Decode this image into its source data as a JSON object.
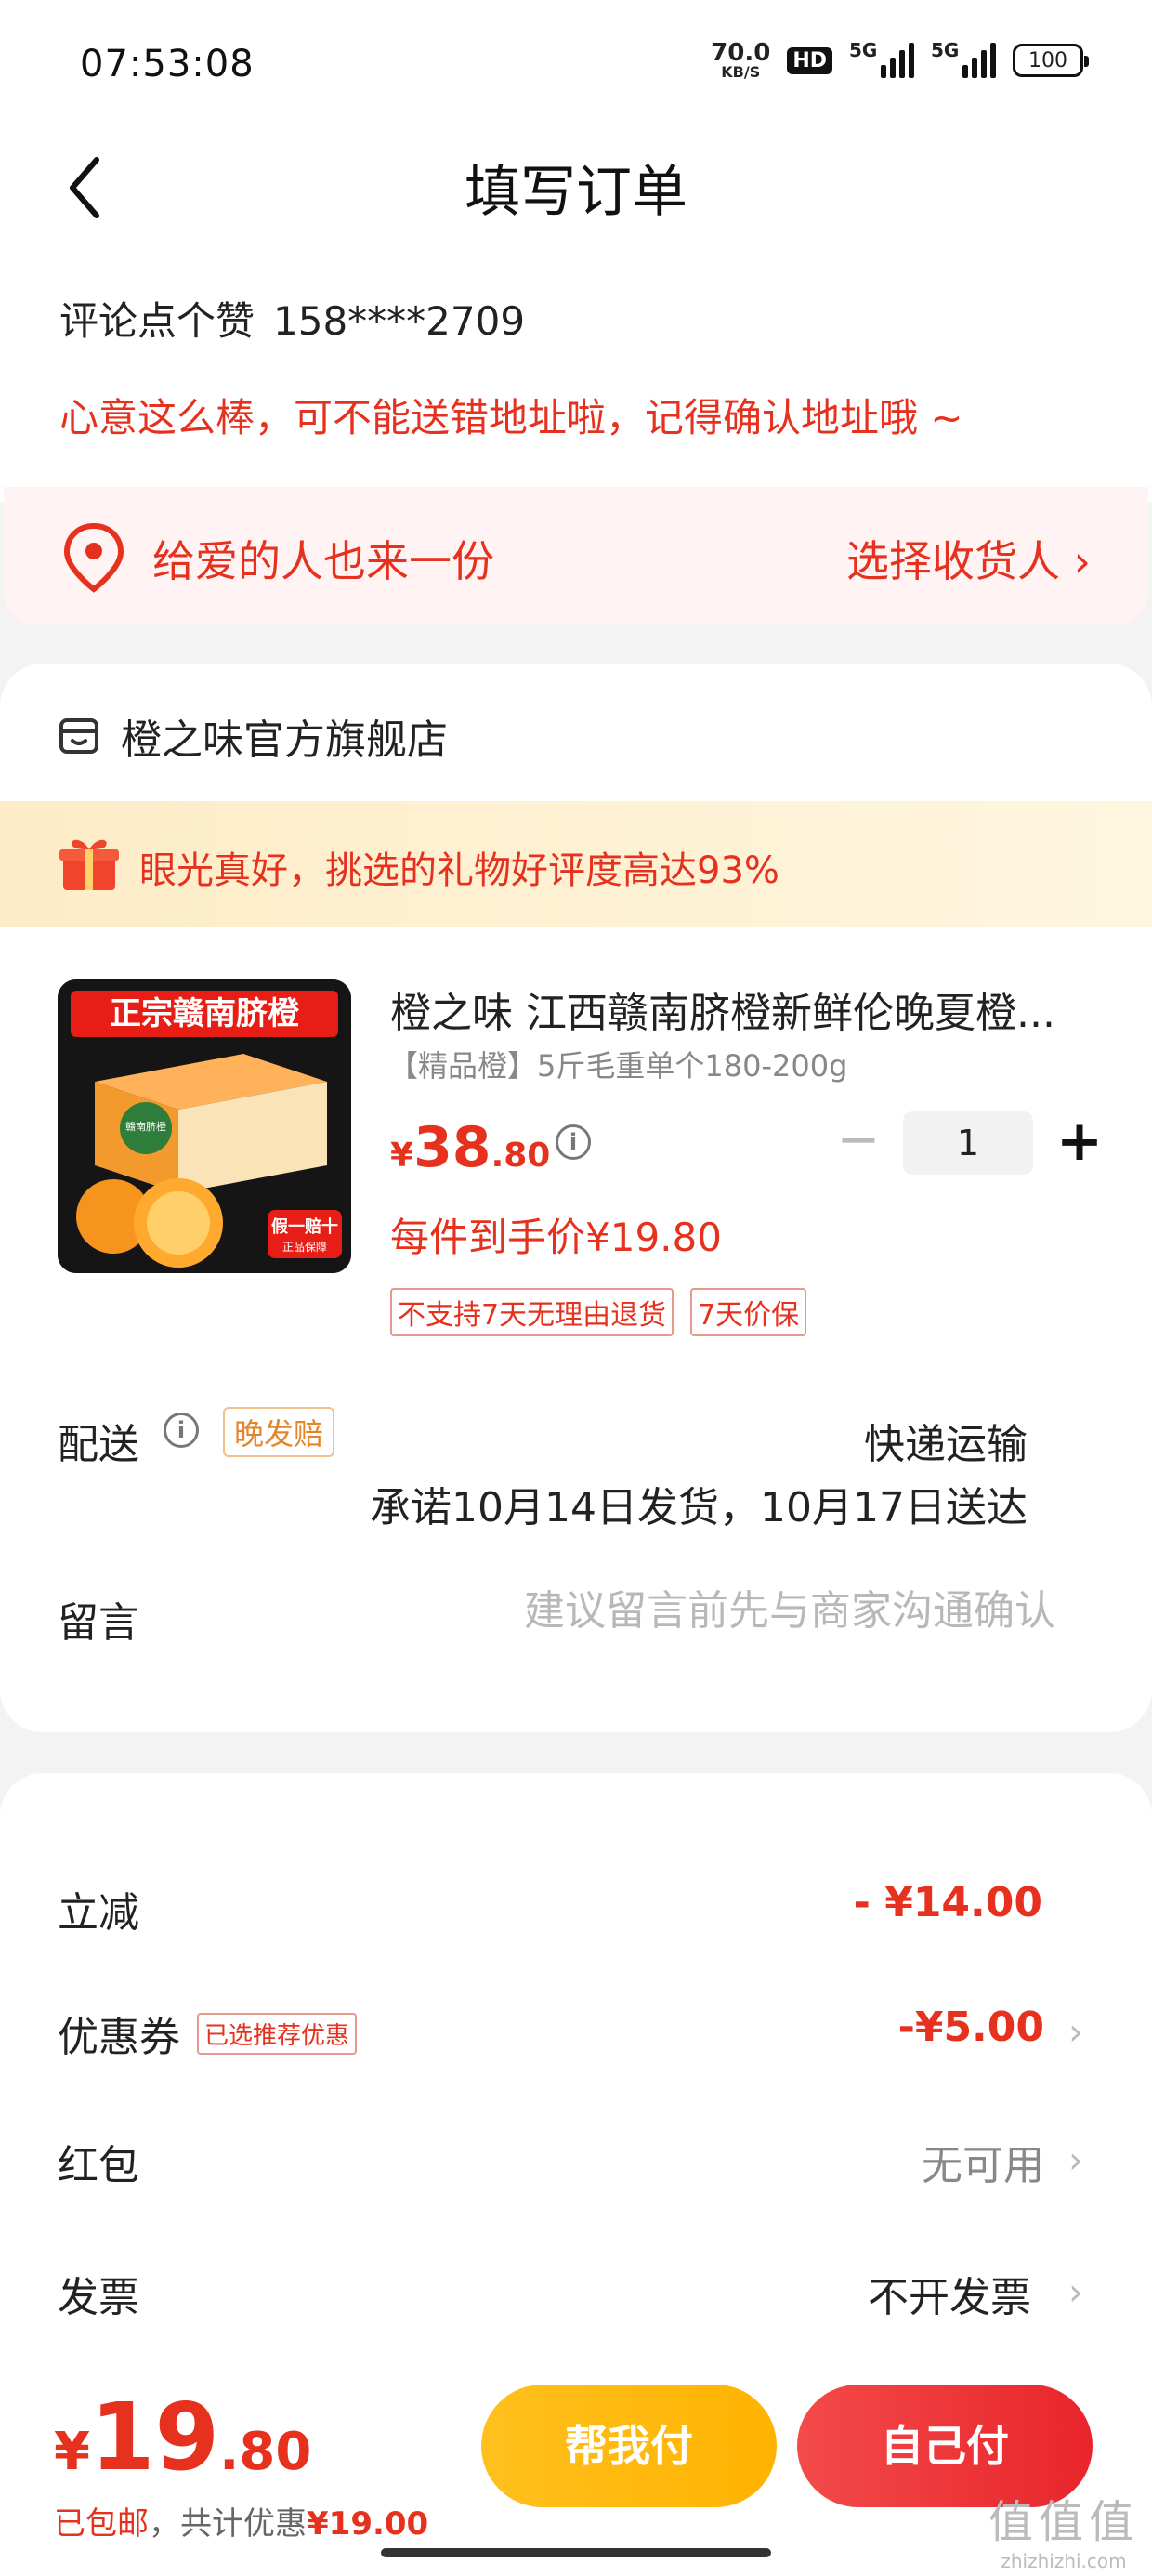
{
  "status_bar": {
    "time": "07:53:08",
    "net_speed_value": "70.0",
    "net_speed_unit": "KB/S",
    "hd_label": "HD",
    "signal1_label": "5G",
    "signal2_label": "5G",
    "battery": "100"
  },
  "header": {
    "title": "填写订单"
  },
  "user": {
    "name": "评论点个赞",
    "phone": "158****2709"
  },
  "hint": "心意这么棒，可不能送错地址啦，记得确认地址哦 ~",
  "recipient": {
    "prompt": "给爱的人也来一份",
    "select_label": "选择收货人 ›"
  },
  "store": {
    "name": "橙之味官方旗舰店",
    "gift_banner": "眼光真好，挑选的礼物好评度高达93%"
  },
  "product": {
    "image_text_top": "正宗赣南脐橙",
    "image_box_label": "赣南脐橙",
    "image_badge_1": "假一赔十",
    "image_badge_2": "正品保障",
    "title": "橙之味 江西赣南脐橙新鲜伦晚夏橙...",
    "spec": "【精品橙】5斤毛重单个180-200g",
    "price_currency": "¥",
    "price_int": "38",
    "price_dec": ".80",
    "quantity": "1",
    "unit_price": "每件到手价¥19.80",
    "tags": [
      "不支持7天无理由退货",
      "7天价保"
    ]
  },
  "delivery": {
    "label": "配送",
    "late_badge": "晚发赔",
    "method": "快递运输",
    "promise": "承诺10月14日发货，10月17日送达"
  },
  "note": {
    "label": "留言",
    "placeholder": "建议留言前先与商家沟通确认"
  },
  "summary": {
    "discount_label": "立减",
    "discount_value": "- ¥14.00",
    "coupon_label": "优惠券",
    "coupon_badge": "已选推荐优惠",
    "coupon_value": "-¥5.00",
    "redpacket_label": "红包",
    "redpacket_value": "无可用",
    "invoice_label": "发票",
    "invoice_value": "不开发票"
  },
  "bottom": {
    "total_currency": "¥",
    "total_int": "19",
    "total_dec": ".80",
    "free_shipping": "已包邮",
    "savings_prefix": "，共计优惠",
    "savings_value": "¥19.00",
    "help_pay_label": "帮我付",
    "self_pay_label": "自己付"
  },
  "watermark": {
    "line1": "值值值",
    "line2": "zhizhizhi.com"
  },
  "colors": {
    "accent_red": "#e5311d",
    "pay_yellow": "#ffb300",
    "pay_red": "#e8252b"
  },
  "icons": [
    "back-icon",
    "location-icon",
    "store-icon",
    "gift-icon",
    "info-icon",
    "chevron-right-icon"
  ]
}
